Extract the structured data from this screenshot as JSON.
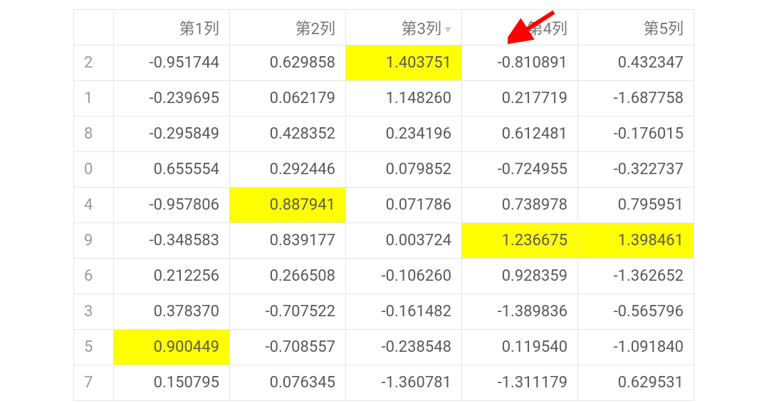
{
  "chart_data": {
    "type": "table",
    "columns": [
      "第1列",
      "第2列",
      "第3列",
      "第4列",
      "第5列"
    ],
    "index": [
      2,
      1,
      8,
      0,
      4,
      9,
      6,
      3,
      5,
      7
    ],
    "sort_column": "第3列",
    "sort_direction": "desc",
    "rows": [
      {
        "idx": 2,
        "c1": "-0.951744",
        "c2": "0.629858",
        "c3": "1.403751",
        "c4": "-0.810891",
        "c5": "0.432347",
        "hl": [
          "c3"
        ]
      },
      {
        "idx": 1,
        "c1": "-0.239695",
        "c2": "0.062179",
        "c3": "1.148260",
        "c4": "0.217719",
        "c5": "-1.687758",
        "hl": []
      },
      {
        "idx": 8,
        "c1": "-0.295849",
        "c2": "0.428352",
        "c3": "0.234196",
        "c4": "0.612481",
        "c5": "-0.176015",
        "hl": []
      },
      {
        "idx": 0,
        "c1": "0.655554",
        "c2": "0.292446",
        "c3": "0.079852",
        "c4": "-0.724955",
        "c5": "-0.322737",
        "hl": []
      },
      {
        "idx": 4,
        "c1": "-0.957806",
        "c2": "0.887941",
        "c3": "0.071786",
        "c4": "0.738978",
        "c5": "0.795951",
        "hl": [
          "c2"
        ]
      },
      {
        "idx": 9,
        "c1": "-0.348583",
        "c2": "0.839177",
        "c3": "0.003724",
        "c4": "1.236675",
        "c5": "1.398461",
        "hl": [
          "c4",
          "c5"
        ]
      },
      {
        "idx": 6,
        "c1": "0.212256",
        "c2": "0.266508",
        "c3": "-0.106260",
        "c4": "0.928359",
        "c5": "-1.362652",
        "hl": []
      },
      {
        "idx": 3,
        "c1": "0.378370",
        "c2": "-0.707522",
        "c3": "-0.161482",
        "c4": "-1.389836",
        "c5": "-0.565796",
        "hl": []
      },
      {
        "idx": 5,
        "c1": "0.900449",
        "c2": "-0.708557",
        "c3": "-0.238548",
        "c4": "0.119540",
        "c5": "-1.091840",
        "hl": [
          "c1"
        ]
      },
      {
        "idx": 7,
        "c1": "0.150795",
        "c2": "0.076345",
        "c3": "-1.360781",
        "c4": "-1.311179",
        "c5": "0.629531",
        "hl": []
      }
    ]
  },
  "annotation": {
    "arrow_color": "#ff0000"
  }
}
